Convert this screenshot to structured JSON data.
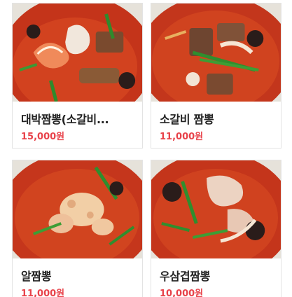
{
  "menu": {
    "items": [
      {
        "name": "대박짬뽕(소갈비...",
        "price": "15,000원"
      },
      {
        "name": "소갈비 짬뽕",
        "price": "11,000원"
      },
      {
        "name": "알짬뽕",
        "price": "11,000원"
      },
      {
        "name": "우삼겹짬뽕",
        "price": "10,000원"
      }
    ]
  },
  "colors": {
    "price": "#e8424a",
    "broth": "#c8381c",
    "bowl": "#e9e4dc"
  }
}
